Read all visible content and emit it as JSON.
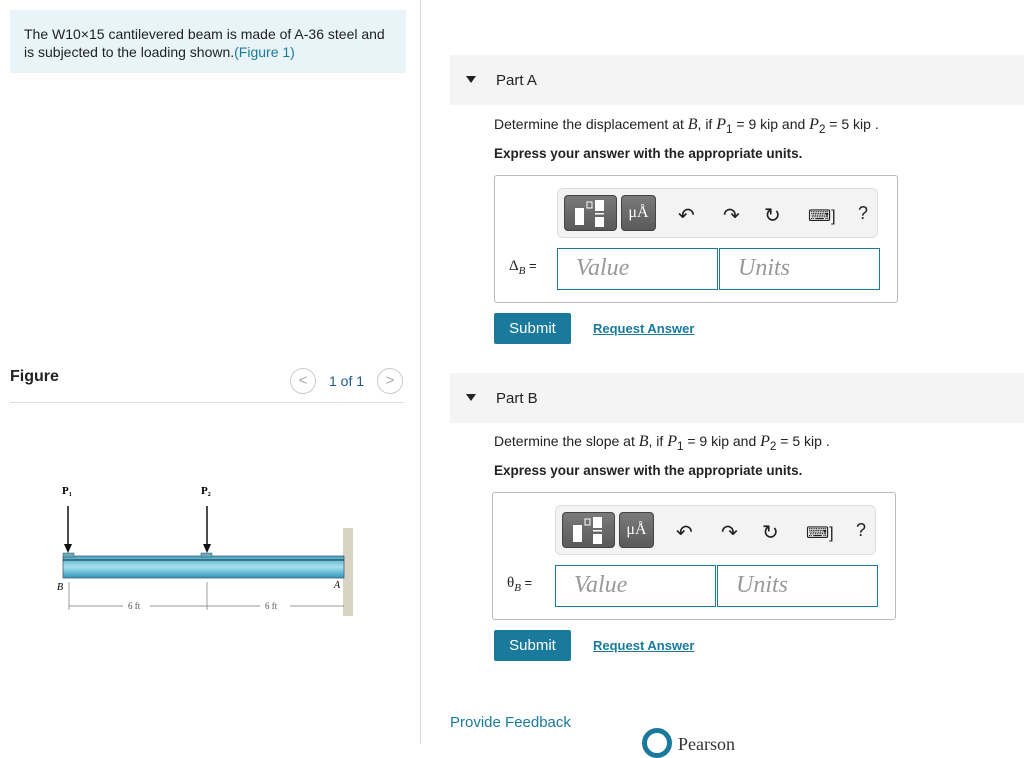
{
  "problem": {
    "text": "The W10×15 cantilevered beam is made of A-36 steel and is subjected to the loading shown.",
    "figure_link": "(Figure 1)"
  },
  "figure": {
    "heading": "Figure",
    "pager": "1 of 1",
    "prev": "<",
    "next": ">",
    "labels": {
      "p1": "P",
      "p1_sub": "1",
      "p2": "P",
      "p2_sub": "2",
      "b": "B",
      "a": "A",
      "dim1": "6 ft",
      "dim2": "6 ft"
    }
  },
  "parts": [
    {
      "label": "Part A",
      "question_pre": "Determine the displacement at ",
      "point": "B",
      "question_mid": ", if ",
      "p1": "P",
      "p1_sub": "1",
      "p1_val": " = 9 kip",
      "and": " and ",
      "p2": "P",
      "p2_sub": "2",
      "p2_val": " = 5 kip",
      "end": " .",
      "express": "Express your answer with the appropriate units.",
      "var": "Δ",
      "var_sub": "B",
      "eq": " =",
      "value_placeholder": "Value",
      "units_placeholder": "Units",
      "submit": "Submit",
      "request": "Request Answer"
    },
    {
      "label": "Part B",
      "question_pre": "Determine the slope at ",
      "point": "B",
      "question_mid": ", if ",
      "p1": "P",
      "p1_sub": "1",
      "p1_val": " = 9 kip",
      "and": " and ",
      "p2": "P",
      "p2_sub": "2",
      "p2_val": " = 5 kip",
      "end": " .",
      "express": "Express your answer with the appropriate units.",
      "var": "θ",
      "var_sub": "B",
      "eq": " =",
      "value_placeholder": "Value",
      "units_placeholder": "Units",
      "submit": "Submit",
      "request": "Request Answer"
    }
  ],
  "toolbar": {
    "units_btn": "μÅ",
    "undo": "↶",
    "redo": "↷",
    "reset": "↻",
    "keyboard": "⌨]",
    "help": "?"
  },
  "footer": {
    "feedback": "Provide Feedback",
    "brand": "Pearson"
  }
}
